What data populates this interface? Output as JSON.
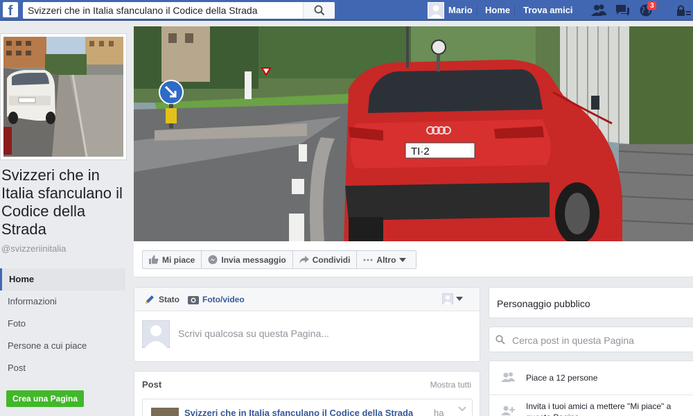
{
  "topbar": {
    "logo": "f",
    "search_value": "Svizzeri che in Italia sfanculano il Codice della Strada",
    "user_name": "Mario",
    "home_label": "Home",
    "find_friends_label": "Trova amici",
    "notification_count": "3",
    "brand_color": "#4267b2"
  },
  "cover": {
    "plate_text": "TI·2"
  },
  "sidebar": {
    "page_name": "Svizzeri che in Italia sfanculano il Codice della Strada",
    "handle": "@svizzeriinitalia",
    "items": [
      {
        "label": "Home",
        "active": true
      },
      {
        "label": "Informazioni"
      },
      {
        "label": "Foto"
      },
      {
        "label": "Persone a cui piace"
      },
      {
        "label": "Post"
      }
    ],
    "create_page_label": "Crea una Pagina"
  },
  "actions": {
    "like_label": "Mi piace",
    "message_label": "Invia messaggio",
    "share_label": "Condividi",
    "more_label": "Altro"
  },
  "composer": {
    "status_tab": "Stato",
    "photo_tab": "Foto/video",
    "placeholder": "Scrivi qualcosa su questa Pagina..."
  },
  "posts": {
    "title": "Post",
    "see_all": "Mostra tutti",
    "first_author": "Svizzeri che in Italia sfanculano il Codice della Strada",
    "first_suffix": "ha"
  },
  "right": {
    "category": "Personaggio pubblico",
    "search_placeholder": "Cerca post in questa Pagina",
    "likes_text": "Piace a 12 persone",
    "invite_text": "Invita i tuoi amici a mettere \"Mi piace\" a questa Pagina"
  }
}
